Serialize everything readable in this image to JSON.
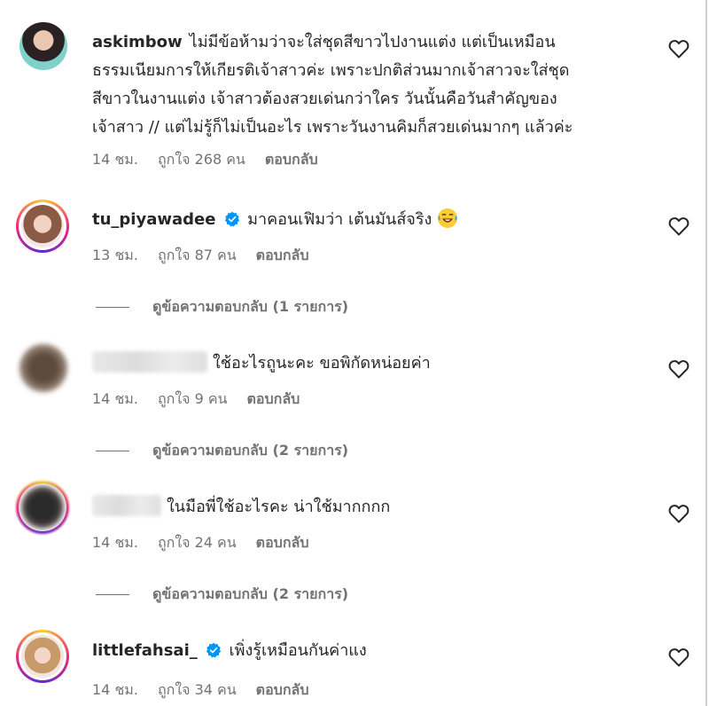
{
  "comments": [
    {
      "username": "askimbow",
      "lines": [
        "ไม่มีข้อห้ามว่าจะใส่ชุดสีขาวไปงานแต่ง แต่เป็นเหมือน",
        "ธรรมเนียมการให้เกียรติเจ้าสาวค่ะ เพราะปกติส่วนมากเจ้าสาวจะใส่ชุด",
        "สีขาวในงานแต่ง เจ้าสาวต้องสวยเด่นกว่าใคร วันนั้นคือวันสำคัญของ",
        "เจ้าสาว // แต่ไม่รู้ก็ไม่เป็นอะไร เพราะวันงานคิมก็สวยเด่นมากๆ แล้วค่ะ"
      ],
      "time": "14 ชม.",
      "likes": "ถูกใจ 268 คน",
      "reply": "ตอบกลับ"
    },
    {
      "username": "tu_piyawadee",
      "verified": true,
      "text": "มาคอนเฟิมว่า เต้นมันส์จริง",
      "emoji": "laughing-crying-emoji",
      "time": "13 ชม.",
      "likes": "ถูกใจ 87 คน",
      "reply": "ตอบกลับ",
      "view_replies": "ดูข้อความตอบกลับ (1 รายการ)"
    },
    {
      "username_hidden": true,
      "text": "ใช้อะไรถูนะคะ ขอพิกัดหน่อยค่า",
      "time": "14 ชม.",
      "likes": "ถูกใจ 9 คน",
      "reply": "ตอบกลับ",
      "view_replies": "ดูข้อความตอบกลับ (2 รายการ)"
    },
    {
      "username_hidden": true,
      "text": "ในมือพี่ใช้อะไรคะ น่าใช้มากกกก",
      "time": "14 ชม.",
      "likes": "ถูกใจ 24 คน",
      "reply": "ตอบกลับ",
      "view_replies": "ดูข้อความตอบกลับ (2 รายการ)"
    },
    {
      "username": "littlefahsai_",
      "verified": true,
      "text": "เพิ่งรู้เหมือนกันค่าแง",
      "time": "14 ชม.",
      "likes": "ถูกใจ 34 คน",
      "reply": "ตอบกลับ"
    }
  ],
  "colors": {
    "text": "#262626",
    "muted": "#737373",
    "verified": "#0095f6"
  },
  "icons": [
    "heart-icon",
    "verified-badge-icon",
    "laughing-crying-emoji"
  ]
}
